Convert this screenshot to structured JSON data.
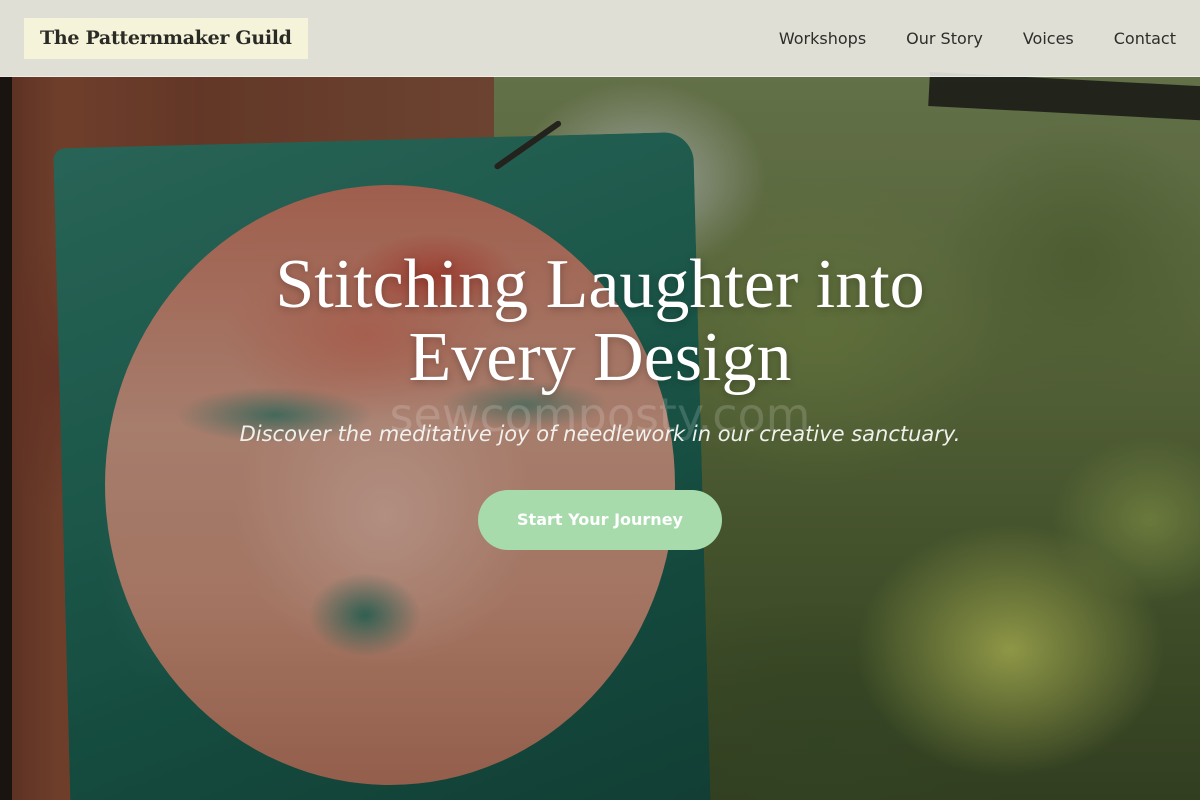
{
  "header": {
    "logo": "The Patternmaker Guild",
    "nav": [
      {
        "label": "Workshops"
      },
      {
        "label": "Our Story"
      },
      {
        "label": "Voices"
      },
      {
        "label": "Contact"
      }
    ]
  },
  "hero": {
    "title_line1": "Stitching Laughter into",
    "title_line2": "Every Design",
    "subtitle": "Discover the meditative joy of needlework in our creative sanctuary.",
    "cta_label": "Start Your Journey",
    "watermark": "sewcomposty.com"
  },
  "colors": {
    "header_bg": "#f0eee8",
    "logo_bg": "#f5f3da",
    "cta_bg": "#a8dbac",
    "text_light": "#ffffff"
  }
}
